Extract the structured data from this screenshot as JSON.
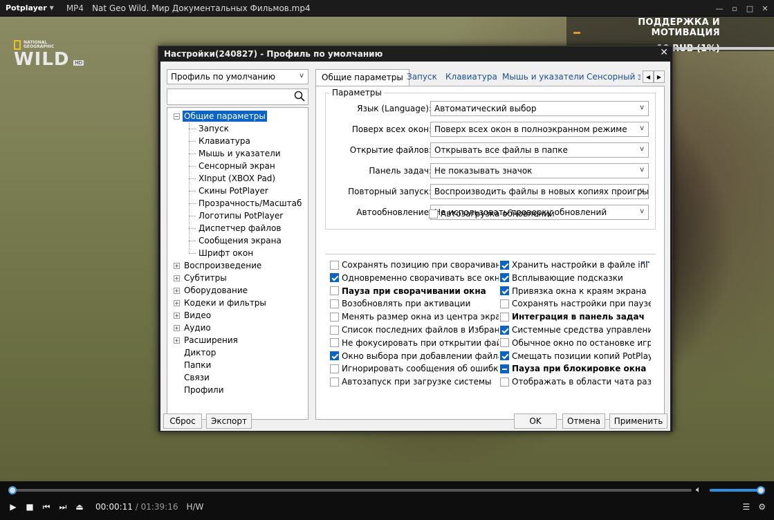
{
  "player": {
    "logo": "Potplayer",
    "format": "MP4",
    "file_title": "Nat Geo Wild. Мир Документальных Фильмов.mp4",
    "window_buttons": [
      "—",
      "▫",
      "□",
      "✕"
    ]
  },
  "video": {
    "channel_small": "NATIONAL GEOGRAPHIC",
    "channel_big": "WILD",
    "channel_badge": "HD",
    "donate_title": "ПОДДЕРЖКА И МОТИВАЦИЯ",
    "donate_amount": "10 RUB (1%)"
  },
  "controls": {
    "time_current": "00:00:11",
    "time_sep": " / ",
    "time_total": "01:39:16",
    "hw": "H/W",
    "seek_progress": 0.002,
    "volume_level": 1.0
  },
  "dialog": {
    "title": "Настройки(240827) - Профиль по умолчанию",
    "profile_combo": "Профиль по умолчанию",
    "search_placeholder": "",
    "tree": [
      {
        "label": "Общие параметры",
        "level": 0,
        "expander": "−",
        "selected": true
      },
      {
        "label": "Запуск",
        "level": 1
      },
      {
        "label": "Клавиатура",
        "level": 1
      },
      {
        "label": "Мышь и указатели",
        "level": 1
      },
      {
        "label": "Сенсорный экран",
        "level": 1
      },
      {
        "label": "XInput (XBOX Pad)",
        "level": 1
      },
      {
        "label": "Скины PotPlayer",
        "level": 1
      },
      {
        "label": "Прозрачность/Масштаб",
        "level": 1
      },
      {
        "label": "Логотипы PotPlayer",
        "level": 1
      },
      {
        "label": "Диспетчер файлов",
        "level": 1
      },
      {
        "label": "Сообщения экрана",
        "level": 1
      },
      {
        "label": "Шрифт окон",
        "level": 1
      },
      {
        "label": "Воспроизведение",
        "level": 0,
        "expander": "+"
      },
      {
        "label": "Субтитры",
        "level": 0,
        "expander": "+"
      },
      {
        "label": "Оборудование",
        "level": 0,
        "expander": "+"
      },
      {
        "label": "Кодеки и фильтры",
        "level": 0,
        "expander": "+"
      },
      {
        "label": "Видео",
        "level": 0,
        "expander": "+"
      },
      {
        "label": "Аудио",
        "level": 0,
        "expander": "+"
      },
      {
        "label": "Расширения",
        "level": 0,
        "expander": "+"
      },
      {
        "label": "Диктор",
        "level": 0
      },
      {
        "label": "Папки",
        "level": 0
      },
      {
        "label": "Связи",
        "level": 0
      },
      {
        "label": "Профили",
        "level": 0
      }
    ],
    "tabs": [
      "Общие параметры",
      "Запуск",
      "Клавиатура",
      "Мышь и указатели",
      "Сенсорный эк"
    ],
    "active_tab": 0,
    "group_title": "Параметры",
    "fields": [
      {
        "label": "Язык (Language):",
        "value": "Автоматический выбор"
      },
      {
        "label": "Поверх всех окон:",
        "value": "Поверх всех окон в полноэкранном режиме"
      },
      {
        "label": "Открытие файлов:",
        "value": "Открывать все файлы в папке"
      },
      {
        "label": "Панель задач:",
        "value": "Не показывать значок"
      },
      {
        "label": "Повторный запуск:",
        "value": "Воспроизводить файлы в новых копиях проигрыват"
      },
      {
        "label": "Автообновление:",
        "value": "Не использовать проверку обновлений"
      }
    ],
    "autoload_updates": {
      "label": "Автозагрузка обновлений",
      "state": "off"
    },
    "checks_left": [
      {
        "label": "Сохранять позицию при сворачивании",
        "state": "off"
      },
      {
        "label": "Одновременно сворачивать все окна",
        "state": "on"
      },
      {
        "label": "Пауза при сворачивании окна",
        "state": "off",
        "bold": true
      },
      {
        "label": "Возобновлять при активации",
        "state": "off"
      },
      {
        "label": "Менять размер окна из центра экрана",
        "state": "off"
      },
      {
        "label": "Список последних файлов в Избранном",
        "state": "off"
      },
      {
        "label": "Не фокусировать при открытии файла",
        "state": "off"
      },
      {
        "label": "Окно выбора при добавлении файла",
        "state": "on"
      },
      {
        "label": "Игнорировать сообщения об ошибках",
        "state": "off"
      },
      {
        "label": "Автозапуск при загрузке системы",
        "state": "off"
      }
    ],
    "checks_right": [
      {
        "label": "Хранить настройки в файле ini",
        "state": "on"
      },
      {
        "label": "Всплывающие подсказки",
        "state": "on"
      },
      {
        "label": "Привязка окна к краям экрана",
        "state": "on"
      },
      {
        "label": "Сохранять настройки при паузе",
        "state": "off"
      },
      {
        "label": "Интеграция в панель задач",
        "state": "off",
        "bold": true
      },
      {
        "label": "Системные средства управления ...",
        "state": "on"
      },
      {
        "label": "Обычное окно по остановке игры",
        "state": "off"
      },
      {
        "label": "Смещать позиции копий PotPlayer",
        "state": "on"
      },
      {
        "label": "Пауза при блокировке окна",
        "state": "indeterminate",
        "bold": true
      },
      {
        "label": "Отображать в области чата различ...",
        "state": "off"
      }
    ],
    "buttons": {
      "reset": "Сброс",
      "export": "Экспорт",
      "ok": "OK",
      "cancel": "Отмена",
      "apply": "Применить"
    }
  },
  "colors": {
    "selection": "#0a64c8",
    "link_tab": "#1a4e9a",
    "seek_accent": "#2d8fe0"
  }
}
